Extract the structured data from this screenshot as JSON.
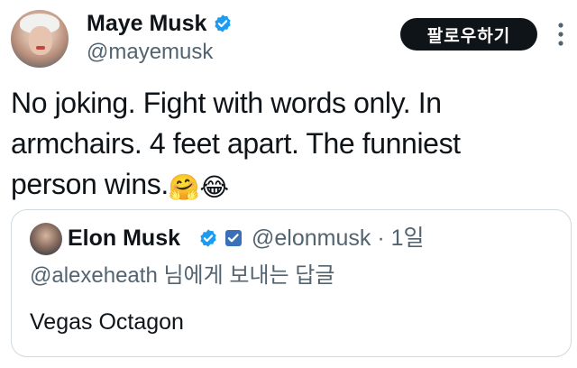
{
  "author": {
    "name": "Maye Musk",
    "handle": "@mayemusk",
    "avatar": "profile-photo",
    "verified": true
  },
  "follow_label": "팔로우하기",
  "tweet": {
    "text": "No joking. Fight with words only. In\narmchairs. 4 feet apart.  The funniest\nperson wins.",
    "emojis": [
      "🤗",
      "😂"
    ]
  },
  "quote": {
    "name": "Elon Musk",
    "handle_meta": "@elonmusk · 1일",
    "reply_line": "@alexeheath 님에게 보내는 답글",
    "text": "Vegas Octagon",
    "verified": true
  },
  "colors": {
    "text": "#0f1419",
    "secondary": "#536471",
    "verified_blue": "#1d9bf0",
    "follow_bg": "#0f1419",
    "border": "#cfd9de"
  }
}
